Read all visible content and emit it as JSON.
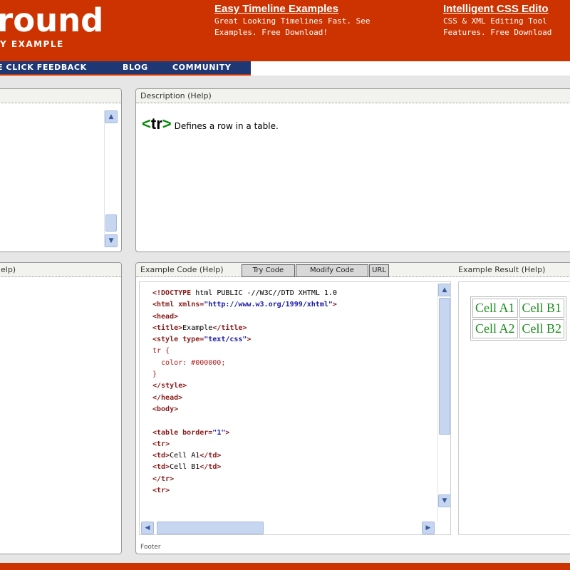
{
  "header": {
    "logo": "round",
    "tagline": "Y EXAMPLE",
    "ad1": {
      "title": "Easy Timeline Examples",
      "line1": "Great Looking Timelines Fast. See",
      "line2": "Examples. Free Download!"
    },
    "ad2": {
      "title": "Intelligent CSS Edito",
      "line1": "CSS & XML Editing Tool",
      "line2": "Features. Free Download"
    }
  },
  "nav": {
    "feedback": "E CLICK FEEDBACK",
    "blog": "BLOG",
    "community": "COMMUNITY"
  },
  "panels": {
    "bottom_left_title": "elp)",
    "description": {
      "title": "Description (Help)",
      "tag": "<tr>",
      "text": "Defines a row in a table."
    },
    "code": {
      "title": "Example Code (Help)",
      "tab_try": "Try Code",
      "tab_modify": "Modify Code",
      "tab_url": "URL",
      "result_title": "Example Result (Help)",
      "footer": "Footer"
    }
  },
  "code_lines": [
    "<!DOCTYPE html PUBLIC \"-//W3C//DTD XHTML 1.0 ",
    "<html xmlns=\"http://www.w3.org/1999/xhtml\">",
    "<head>",
    "<title>Example</title>",
    "<style type=\"text/css\">",
    "tr {",
    "  color: #000000;",
    "}",
    "</style>",
    "</head>",
    "<body>",
    "",
    "<table border=\"1\">",
    "<tr>",
    "<td>Cell A1</td>",
    "<td>Cell B1</td>",
    "</tr>",
    "<tr>"
  ],
  "result_table": [
    [
      "Cell A1",
      "Cell B1"
    ],
    [
      "Cell A2",
      "Cell B2"
    ]
  ],
  "colors": {
    "brand": "#cc3300",
    "nav": "#1f3874",
    "result_text": "#1c8c1c"
  }
}
